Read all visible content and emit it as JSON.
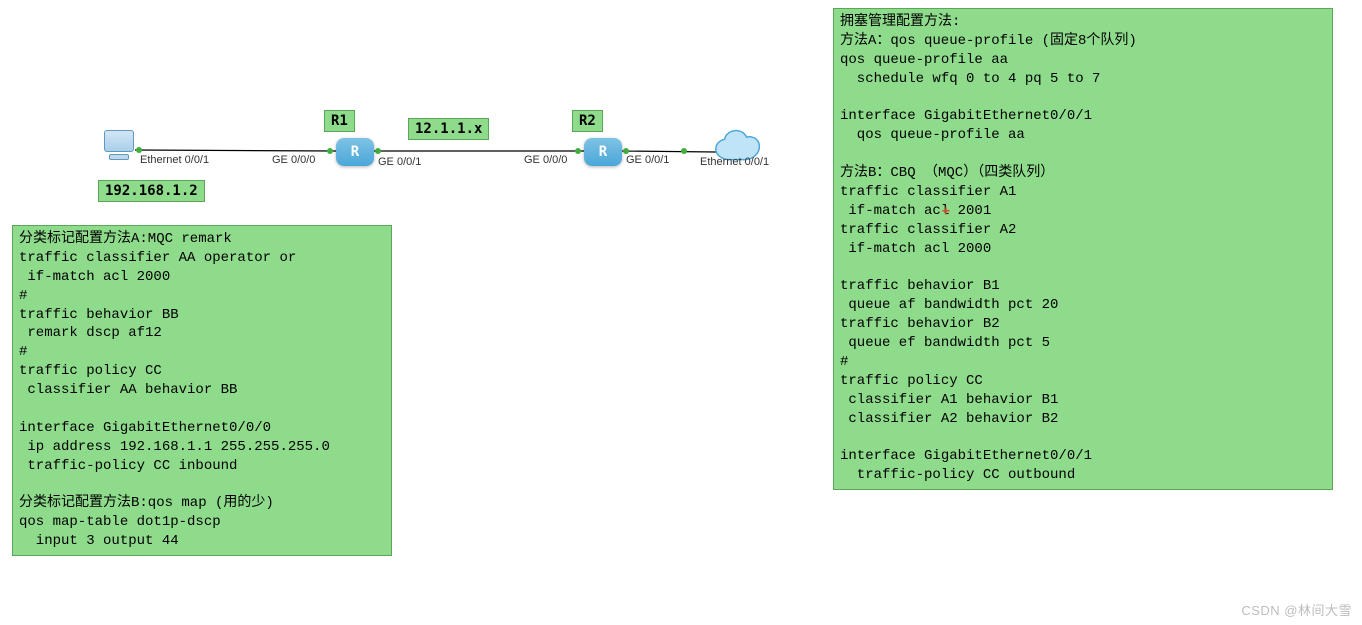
{
  "topology": {
    "r1_label": "R1",
    "r2_label": "R2",
    "subnet_label": "12.1.1.x",
    "pc_ip_label": "192.168.1.2",
    "port_pc": "Ethernet 0/0/1",
    "port_r1_left": "GE 0/0/0",
    "port_r1_right": "GE 0/0/1",
    "port_r2_left": "GE 0/0/0",
    "port_r2_right": "GE 0/0/1",
    "port_cloud": "Ethernet 0/0/1"
  },
  "config_left": "分类标记配置方法A:MQC remark\ntraffic classifier AA operator or\n if-match acl 2000\n#\ntraffic behavior BB\n remark dscp af12\n#\ntraffic policy CC\n classifier AA behavior BB\n\ninterface GigabitEthernet0/0/0\n ip address 192.168.1.1 255.255.255.0\n traffic-policy CC inbound\n\n分类标记配置方法B:qos map (用的少)\nqos map-table dot1p-dscp\n  input 3 output 44",
  "config_right": "拥塞管理配置方法:\n方法A：qos queue-profile (固定8个队列)\nqos queue-profile aa\n  schedule wfq 0 to 4 pq 5 to 7\n\ninterface GigabitEthernet0/0/1\n  qos queue-profile aa\n\n方法B：CBQ （MQC）（四类队列）\ntraffic classifier A1\n if-match acl 2001\ntraffic classifier A2\n if-match acl 2000\n\ntraffic behavior B1\n queue af bandwidth pct 20\ntraffic behavior B2\n queue ef bandwidth pct 5\n#\ntraffic policy CC\n classifier A1 behavior B1\n classifier A2 behavior B2\n\ninterface GigabitEthernet0/0/1\n  traffic-policy CC outbound",
  "watermark": "CSDN @林间大雪"
}
